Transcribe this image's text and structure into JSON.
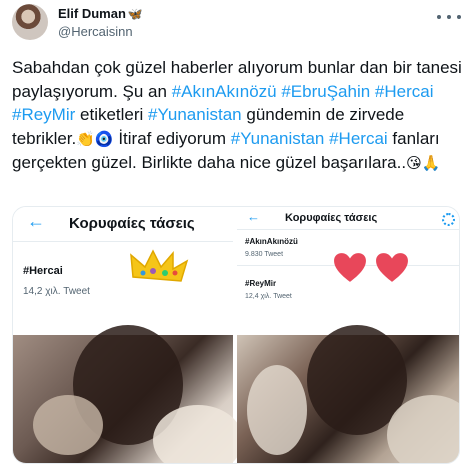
{
  "author": {
    "name": "Elif Duman",
    "badge_emoji": "🦋",
    "handle": "@Hercaisinn"
  },
  "icons": {
    "more": "more-horizontal-icon",
    "back": "back-arrow-icon",
    "settings": "gear-icon",
    "crown": "crown-icon",
    "heart": "heart-icon"
  },
  "tweet": {
    "t1": "Sabahdan çok güzel haberler alıyorum bunlar dan bir tanesi paylaşıyorum. Şu an ",
    "tag1": "#AkınAkınözü",
    "t2": " ",
    "tag2": "#EbruŞahin",
    "t3": " ",
    "tag3": "#Hercai",
    "t4": " ",
    "tag4": "#ReyMir",
    "t5": " etiketleri ",
    "tag5": "#Yunanistan",
    "t6": " gündemin de zirvede tebrikler.",
    "emoji1": "👏🧿",
    "t7": " İtiraf ediyorum ",
    "tag6": "#Yunanistan",
    "t8": " ",
    "tag7": "#Hercai",
    "t9": " fanları gerçekten güzel. Birlikte daha nice güzel başarılara..",
    "emoji2": "😘🙏"
  },
  "media": {
    "left": {
      "title": "Κορυφαίες τάσεις",
      "trends": [
        {
          "tag": "#Hercai",
          "count": "14,2 χιλ. Tweet"
        }
      ]
    },
    "right": {
      "title": "Κορυφαίες τάσεις",
      "trends": [
        {
          "tag": "#AkınAkınözü",
          "count": "9.830 Tweet"
        },
        {
          "tag": "#ReyMir",
          "count": "12,4 χιλ. Tweet"
        }
      ]
    }
  },
  "colors": {
    "accent": "#1d9bf0",
    "text": "#0f1419",
    "muted": "#536471",
    "heart": "#e8475a",
    "crown": "#f5c518"
  }
}
